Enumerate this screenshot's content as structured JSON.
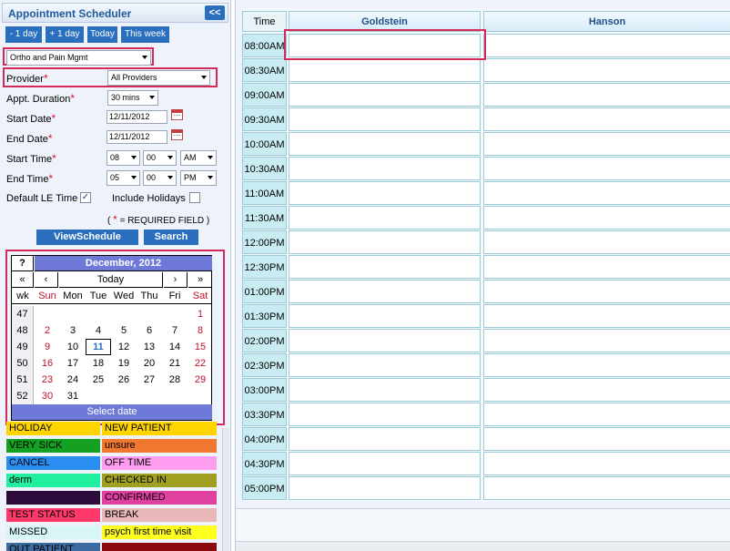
{
  "header": {
    "title": "Appointment Scheduler",
    "collapse_label": "<<"
  },
  "nav_buttons": [
    "- 1 day",
    "+ 1 day",
    "Today",
    "This week"
  ],
  "facility": {
    "value": "Ortho and Pain Mgmt"
  },
  "form": {
    "provider_label": "Provider",
    "provider_value": "All Providers",
    "duration_label": "Appt. Duration",
    "duration_value": "30 mins",
    "start_date_label": "Start Date",
    "start_date_value": "12/11/2012",
    "end_date_label": "End Date",
    "end_date_value": "12/11/2012",
    "start_time_label": "Start Time",
    "start_hour": "08",
    "start_min": "00",
    "start_ampm": "AM",
    "end_time_label": "End Time",
    "end_hour": "05",
    "end_min": "00",
    "end_ampm": "PM",
    "default_le_label": "Default LE Time",
    "default_le_checked": "✓",
    "include_holidays_label": "Include Holidays",
    "required_star": "*",
    "required_note_open": "(",
    "required_note_text": "= REQUIRED FIELD )",
    "view_button": "ViewSchedule",
    "search_button": "Search"
  },
  "calendar": {
    "help": "?",
    "title": "December, 2012",
    "nav": [
      "«",
      "‹",
      "Today",
      "›",
      "»"
    ],
    "head": [
      "wk",
      "Sun",
      "Mon",
      "Tue",
      "Wed",
      "Thu",
      "Fri",
      "Sat"
    ],
    "weeks": [
      {
        "wk": "47",
        "days": [
          "",
          "",
          "",
          "",
          "",
          "",
          "1"
        ]
      },
      {
        "wk": "48",
        "days": [
          "2",
          "3",
          "4",
          "5",
          "6",
          "7",
          "8"
        ]
      },
      {
        "wk": "49",
        "days": [
          "9",
          "10",
          "11",
          "12",
          "13",
          "14",
          "15"
        ]
      },
      {
        "wk": "50",
        "days": [
          "16",
          "17",
          "18",
          "19",
          "20",
          "21",
          "22"
        ]
      },
      {
        "wk": "51",
        "days": [
          "23",
          "24",
          "25",
          "26",
          "27",
          "28",
          "29"
        ]
      },
      {
        "wk": "52",
        "days": [
          "30",
          "31",
          "",
          "",
          "",
          "",
          ""
        ]
      }
    ],
    "today": "11",
    "select_label": "Select date"
  },
  "legend": [
    {
      "left": "HOLIDAY",
      "left_bg": "#ffd400",
      "right": "NEW PATIENT",
      "right_bg": "#ffd400"
    },
    {
      "left": "VERY SICK",
      "left_bg": "#14a020",
      "right": "unsure",
      "right_bg": "#f07830"
    },
    {
      "left": "CANCEL",
      "left_bg": "#2a8ef0",
      "right": "OFF TIME",
      "right_bg": "#ff9ef0"
    },
    {
      "left": "derm",
      "left_bg": "#22f0a0",
      "right": "CHECKED IN",
      "right_bg": "#a0a020"
    },
    {
      "left": "",
      "left_bg": "#2c0a3a",
      "right": "CONFIRMED",
      "right_bg": "#e040a0"
    },
    {
      "left": "TEST STATUS",
      "left_bg": "#ff3a6a",
      "right": "BREAK",
      "right_bg": "#e8b8b8"
    },
    {
      "left": "MISSED",
      "left_bg": "#d8f6f6",
      "right": "psych first time visit",
      "right_bg": "#ffff20"
    },
    {
      "left": "OUT PATIENT",
      "left_bg": "#3a6aa0",
      "right": "",
      "right_bg": "#8a0a10"
    }
  ],
  "schedule": {
    "time_header": "Time",
    "providers": [
      "Goldstein",
      "Hanson"
    ],
    "times": [
      "08:00AM",
      "08:30AM",
      "09:00AM",
      "09:30AM",
      "10:00AM",
      "10:30AM",
      "11:00AM",
      "11:30AM",
      "12:00PM",
      "12:30PM",
      "01:00PM",
      "01:30PM",
      "02:00PM",
      "02:30PM",
      "03:00PM",
      "03:30PM",
      "04:00PM",
      "04:30PM",
      "05:00PM"
    ]
  }
}
